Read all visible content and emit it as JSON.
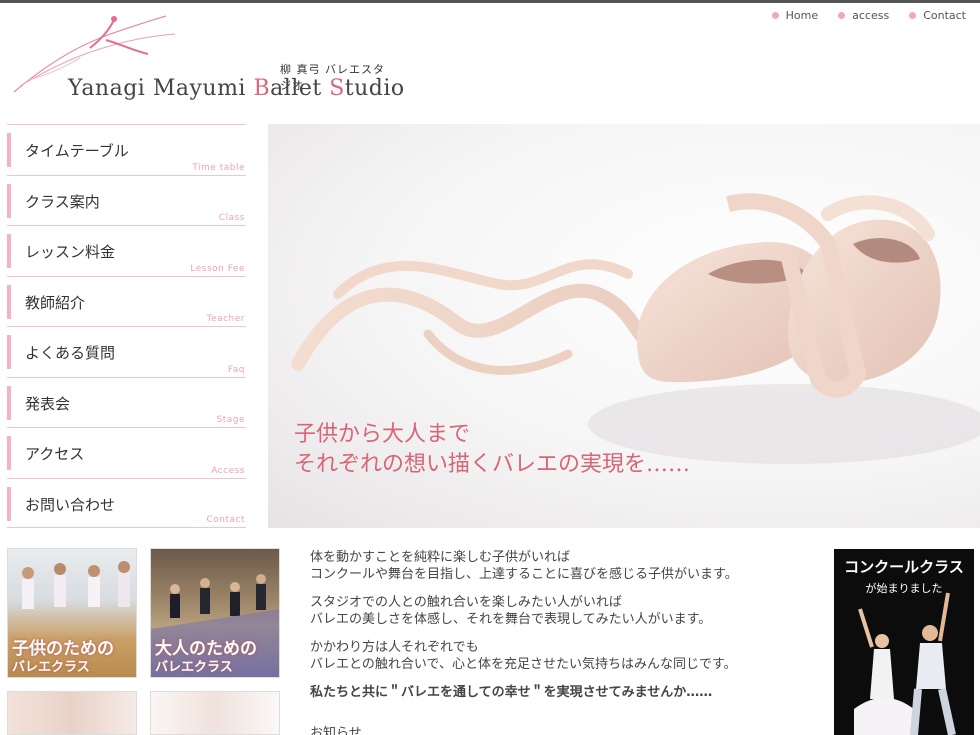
{
  "header": {
    "nav": [
      {
        "label": "Home"
      },
      {
        "label": "access"
      },
      {
        "label": "Contact"
      }
    ],
    "logo": {
      "sub": "柳 真弓 バレエスタジオ",
      "main_a": "Yanagi Mayumi ",
      "main_b": "B",
      "main_c": "allet ",
      "main_d": "S",
      "main_e": "tudio"
    }
  },
  "menu": [
    {
      "jp": "タイムテーブル",
      "en": "Time table"
    },
    {
      "jp": "クラス案内",
      "en": "Class"
    },
    {
      "jp": "レッスン料金",
      "en": "Lesson Fee"
    },
    {
      "jp": "教師紹介",
      "en": "Teacher"
    },
    {
      "jp": "よくある質問",
      "en": "Faq"
    },
    {
      "jp": "発表会",
      "en": "Stage"
    },
    {
      "jp": "アクセス",
      "en": "Access"
    },
    {
      "jp": "お問い合わせ",
      "en": "Contact"
    }
  ],
  "hero": {
    "line1": "子供から大人まで",
    "line2": "それぞれの想い描くバレエの実現を……"
  },
  "thumbs": {
    "kids": {
      "cap1": "子供のための",
      "cap2": "バレエクラス"
    },
    "adults": {
      "cap1": "大人のための",
      "cap2": "バレエクラス"
    }
  },
  "intro": {
    "p1a": "体を動かすことを純粋に楽しむ子供がいれば",
    "p1b": "コンクールや舞台を目指し、上達することに喜びを感じる子供がいます。",
    "p2a": "スタジオでの人との触れ合いを楽しみたい人がいれば",
    "p2b": "バレエの美しさを体感し、それを舞台で表現してみたい人がいます。",
    "p3a": "かかわり方は人それぞれでも",
    "p3b": "バレエとの触れ合いで、心と体を充足させたい気持ちはみんな同じです。",
    "p4": "私たちと共に＂バレエを通しての幸せ＂を実現させてみませんか……",
    "notice": "お知らせ"
  },
  "banner": {
    "title": "コンクールクラス",
    "sub": "が始まりました"
  },
  "colors": {
    "accent": "#f3b3c0",
    "hero_text": "#d86576"
  }
}
